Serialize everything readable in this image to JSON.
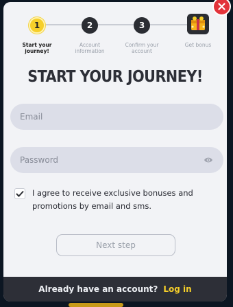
{
  "colors": {
    "accent": "#f6cf2a",
    "close": "#e2323a",
    "footer_bg": "#2d2f37",
    "modal_bg": "#f2f3f6"
  },
  "close_button": {
    "icon": "close-icon"
  },
  "stepper": {
    "steps": [
      {
        "number": "1",
        "label_line1": "Start your",
        "label_line2": "journey!",
        "state": "active"
      },
      {
        "number": "2",
        "label_line1": "Account",
        "label_line2": "information",
        "state": "inactive"
      },
      {
        "number": "3",
        "label_line1": "Confirm your",
        "label_line2": "account",
        "state": "inactive"
      },
      {
        "icon": "gift-chest-icon",
        "label_line1": "Get bonus",
        "label_line2": "",
        "state": "inactive"
      }
    ]
  },
  "form": {
    "title": "START YOUR JOURNEY!",
    "email": {
      "value": "",
      "placeholder": "Email"
    },
    "password": {
      "value": "",
      "placeholder": "Password",
      "icon": "eye-icon"
    },
    "agree": {
      "checked": true,
      "text": "I agree to receive exclusive bonuses and promotions by email and sms."
    },
    "next_label": "Next step"
  },
  "footer": {
    "question": "Already have an account?",
    "login_label": "Log in"
  }
}
